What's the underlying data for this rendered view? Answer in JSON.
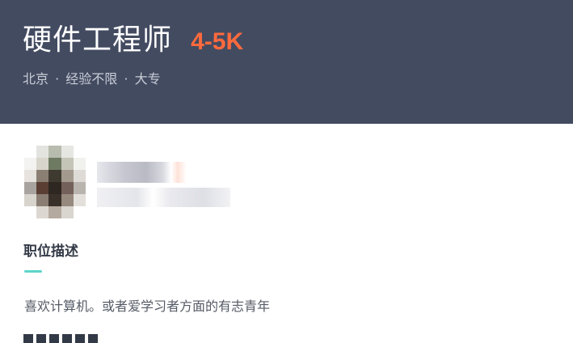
{
  "job": {
    "title": "硬件工程师",
    "salary": "4-5K",
    "city": "北京",
    "experience": "经验不限",
    "education": "大专",
    "separator": "·"
  },
  "description": {
    "heading": "职位描述",
    "text": "喜欢计算机。或者爱学习者方面的有志青年"
  },
  "colors": {
    "header_bg": "#434b61",
    "salary": "#ff6a3d",
    "accent_underline": "#5dd5c8"
  }
}
